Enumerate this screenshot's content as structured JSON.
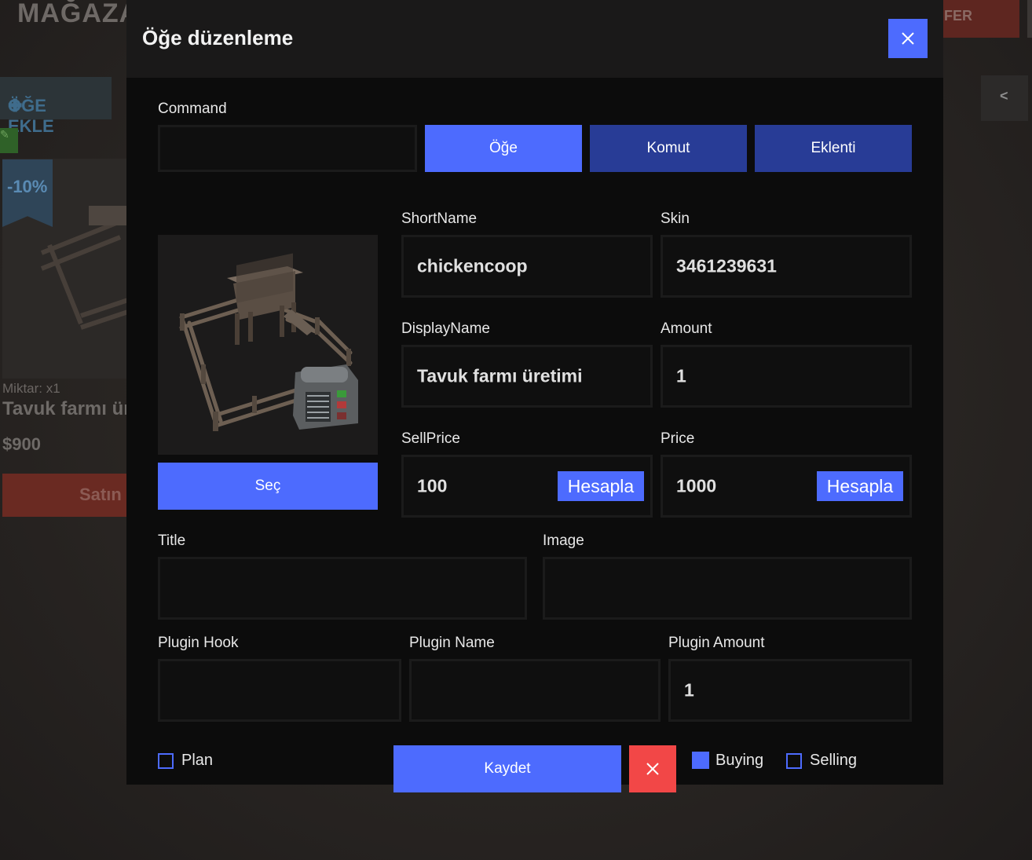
{
  "background": {
    "store_title": "MAĞAZA",
    "top_button_text": "FER",
    "add_item_label": "ÖĞE EKLE",
    "back_label": "<",
    "card": {
      "discount": "-10%",
      "quantity": "Miktar: x1",
      "name": "Tavuk farmı üre",
      "price": "$900",
      "buy_label": "Satın"
    }
  },
  "modal": {
    "title": "Öğe düzenleme",
    "command_label": "Command",
    "command_value": "",
    "type_tabs": [
      "Öğe",
      "Komut",
      "Eklenti"
    ],
    "active_tab": "Öğe",
    "select_button": "Seç",
    "shortname_label": "ShortName",
    "shortname_value": "chickencoop",
    "skin_label": "Skin",
    "skin_value": "3461239631",
    "displayname_label": "DisplayName",
    "displayname_value": "Tavuk farmı üretimi",
    "amount_label": "Amount",
    "amount_value": "1",
    "sellprice_label": "SellPrice",
    "sellprice_value": "100",
    "price_label": "Price",
    "price_value": "1000",
    "calc_button": "Hesapla",
    "title_label": "Title",
    "title_value": "",
    "image_label": "Image",
    "image_value": "",
    "plugin_hook_label": "Plugin Hook",
    "plugin_hook_value": "",
    "plugin_name_label": "Plugin Name",
    "plugin_name_value": "",
    "plugin_amount_label": "Plugin Amount",
    "plugin_amount_value": "1",
    "plan_label": "Plan",
    "plan_checked": false,
    "save_button": "Kaydet",
    "buying_label": "Buying",
    "buying_checked": true,
    "selling_label": "Selling",
    "selling_checked": false
  },
  "colors": {
    "accent": "#4d6bfe",
    "tab_inactive": "#283c96",
    "danger": "#f24747",
    "panel": "#0c0c0c",
    "header": "#1a1919"
  }
}
